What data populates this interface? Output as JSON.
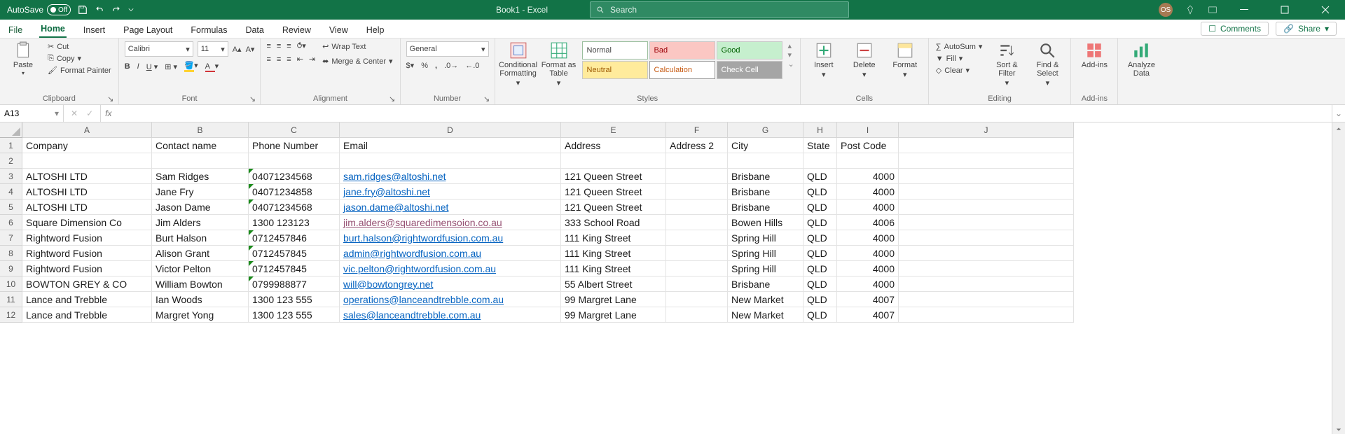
{
  "titlebar": {
    "autosave_label": "AutoSave",
    "autosave_state": "Off",
    "doc_title": "Book1 - Excel",
    "search_placeholder": "Search",
    "user_initials": "OS"
  },
  "menu": {
    "tabs": [
      "File",
      "Home",
      "Insert",
      "Page Layout",
      "Formulas",
      "Data",
      "Review",
      "View",
      "Help"
    ],
    "active": "Home",
    "comments_label": "Comments",
    "share_label": "Share"
  },
  "ribbon": {
    "clipboard": {
      "paste": "Paste",
      "cut": "Cut",
      "copy": "Copy",
      "format_painter": "Format Painter",
      "group": "Clipboard"
    },
    "font": {
      "name": "Calibri",
      "size": "11",
      "group": "Font"
    },
    "alignment": {
      "wrap": "Wrap Text",
      "merge": "Merge & Center",
      "group": "Alignment"
    },
    "number": {
      "format": "General",
      "group": "Number"
    },
    "styles": {
      "cond": "Conditional Formatting",
      "table": "Format as Table",
      "normal": "Normal",
      "bad": "Bad",
      "good": "Good",
      "neutral": "Neutral",
      "calc": "Calculation",
      "check": "Check Cell",
      "group": "Styles"
    },
    "cells": {
      "insert": "Insert",
      "delete": "Delete",
      "format": "Format",
      "group": "Cells"
    },
    "editing": {
      "autosum": "AutoSum",
      "fill": "Fill",
      "clear": "Clear",
      "sort": "Sort & Filter",
      "find": "Find & Select",
      "group": "Editing"
    },
    "addins": {
      "label": "Add-ins",
      "group": "Add-ins"
    },
    "analyze": {
      "label": "Analyze Data"
    }
  },
  "formulabar": {
    "namebox": "A13",
    "formula": ""
  },
  "columns": [
    "A",
    "B",
    "C",
    "D",
    "E",
    "F",
    "G",
    "H",
    "I",
    "J"
  ],
  "headers": {
    "A": "Company",
    "B": "Contact name",
    "C": "Phone Number",
    "D": "Email",
    "E": "Address",
    "F": "Address 2",
    "G": "City",
    "H": "State",
    "I": "Post Code"
  },
  "rows": [
    {
      "n": 3,
      "A": "ALTOSHI LTD",
      "B": "Sam Ridges",
      "C": "04071234568",
      "D": "sam.ridges@altoshi.net",
      "E": "121 Queen Street",
      "F": "",
      "G": "Brisbane",
      "H": "QLD",
      "I": "4000",
      "err": true
    },
    {
      "n": 4,
      "A": "ALTOSHI LTD",
      "B": "Jane Fry",
      "C": "04071234858",
      "D": "jane.fry@altoshi.net",
      "E": "121 Queen Street",
      "F": "",
      "G": "Brisbane",
      "H": "QLD",
      "I": "4000",
      "err": true
    },
    {
      "n": 5,
      "A": "ALTOSHI LTD",
      "B": "Jason Dame",
      "C": "04071234568",
      "D": "jason.dame@altoshi.net",
      "E": "121 Queen Street",
      "F": "",
      "G": "Brisbane",
      "H": "QLD",
      "I": "4000",
      "err": true
    },
    {
      "n": 6,
      "A": "Square Dimension Co",
      "B": "Jim Alders",
      "C": "1300 123123",
      "D": "jim.alders@squaredimensoion.co.au",
      "E": "333 School Road",
      "F": "",
      "G": "Bowen Hills",
      "H": "QLD",
      "I": "4006",
      "visited": true
    },
    {
      "n": 7,
      "A": "Rightword Fusion",
      "B": "Burt Halson",
      "C": "0712457846",
      "D": "burt.halson@rightwordfusion.com.au",
      "E": "111 King Street",
      "F": "",
      "G": "Spring Hill",
      "H": "QLD",
      "I": "4000",
      "err": true
    },
    {
      "n": 8,
      "A": "Rightword Fusion",
      "B": "Alison Grant",
      "C": "0712457845",
      "D": "admin@rightwordfusion.com.au",
      "E": "111 King Street",
      "F": "",
      "G": "Spring Hill",
      "H": "QLD",
      "I": "4000",
      "err": true
    },
    {
      "n": 9,
      "A": "Rightword Fusion",
      "B": "Victor Pelton",
      "C": "0712457845",
      "D": "vic.pelton@rightwordfusion.com.au",
      "E": "111 King Street",
      "F": "",
      "G": "Spring Hill",
      "H": "QLD",
      "I": "4000",
      "err": true
    },
    {
      "n": 10,
      "A": "BOWTON GREY & CO",
      "B": "William Bowton",
      "C": "0799988877",
      "D": "will@bowtongrey.net",
      "E": "55 Albert Street",
      "F": "",
      "G": "Brisbane",
      "H": "QLD",
      "I": "4000",
      "err": true
    },
    {
      "n": 11,
      "A": "Lance and Trebble",
      "B": "Ian Woods",
      "C": "1300 123 555",
      "D": "operations@lanceandtrebble.com.au",
      "E": "99 Margret Lane",
      "F": "",
      "G": "New Market",
      "H": "QLD",
      "I": "4007"
    },
    {
      "n": 12,
      "A": "Lance and Trebble",
      "B": "Margret Yong",
      "C": "1300 123 555",
      "D": "sales@lanceandtrebble.com.au",
      "E": "99 Margret Lane",
      "F": "",
      "G": "New Market",
      "H": "QLD",
      "I": "4007"
    }
  ]
}
